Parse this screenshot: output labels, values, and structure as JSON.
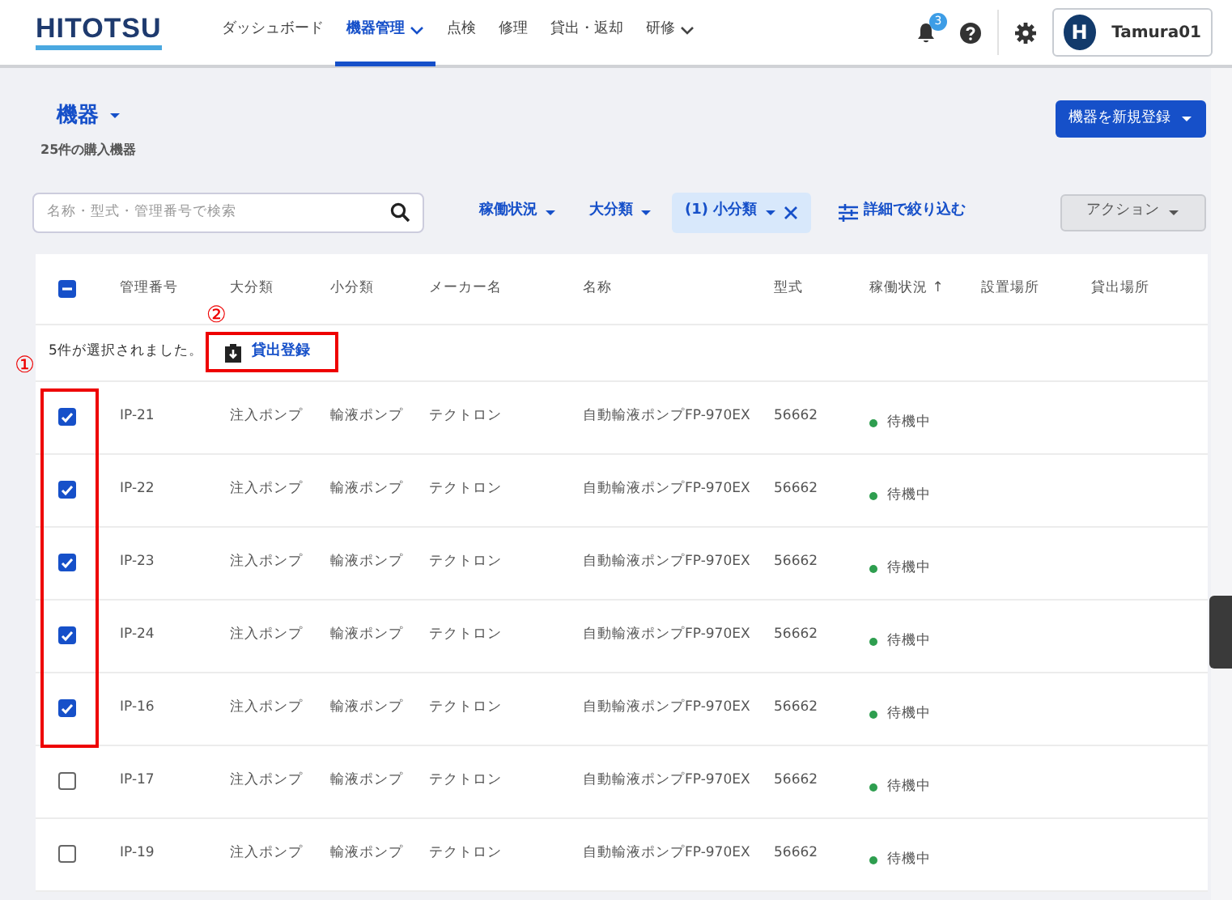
{
  "header": {
    "logo": "HITOTSU",
    "nav": [
      {
        "label": "ダッシュボード",
        "selected": false,
        "dropdown": false
      },
      {
        "label": "機器管理",
        "selected": true,
        "dropdown": true
      },
      {
        "label": "点検",
        "selected": false,
        "dropdown": false
      },
      {
        "label": "修理",
        "selected": false,
        "dropdown": false
      },
      {
        "label": "貸出・返却",
        "selected": false,
        "dropdown": false
      },
      {
        "label": "研修",
        "selected": false,
        "dropdown": true
      }
    ],
    "notification_count": "3",
    "user": {
      "avatar": "H",
      "name": "Tamura01"
    }
  },
  "page": {
    "title": "機器",
    "subtitle": "25件の購入機器",
    "new_button": "機器を新規登録"
  },
  "filters": {
    "search_placeholder": "名称・型式・管理番号で検索",
    "items": [
      {
        "label": "稼働状況",
        "active": false
      },
      {
        "label": "大分類",
        "active": false
      },
      {
        "label": "(1) 小分類",
        "active": true
      }
    ],
    "detail": "詳細で絞り込む",
    "action": "アクション"
  },
  "table": {
    "select_all": {
      "checked": true,
      "indeterminate": true
    },
    "columns": [
      "管理番号",
      "大分類",
      "小分類",
      "メーカー名",
      "名称",
      "型式",
      "稼働状況 ↑",
      "設置場所",
      "貸出場所"
    ],
    "selection": {
      "message": "5件が選択されました。",
      "button": "貸出登録"
    },
    "rows": [
      {
        "checked": true,
        "cells": [
          "IP-21",
          "注入ポンプ",
          "輸液ポンプ",
          "テクトロン",
          "自動輸液ポンプFP-970EX",
          "56662"
        ],
        "status": "待機中"
      },
      {
        "checked": true,
        "cells": [
          "IP-22",
          "注入ポンプ",
          "輸液ポンプ",
          "テクトロン",
          "自動輸液ポンプFP-970EX",
          "56662"
        ],
        "status": "待機中"
      },
      {
        "checked": true,
        "cells": [
          "IP-23",
          "注入ポンプ",
          "輸液ポンプ",
          "テクトロン",
          "自動輸液ポンプFP-970EX",
          "56662"
        ],
        "status": "待機中"
      },
      {
        "checked": true,
        "cells": [
          "IP-24",
          "注入ポンプ",
          "輸液ポンプ",
          "テクトロン",
          "自動輸液ポンプFP-970EX",
          "56662"
        ],
        "status": "待機中"
      },
      {
        "checked": true,
        "cells": [
          "IP-16",
          "注入ポンプ",
          "輸液ポンプ",
          "テクトロン",
          "自動輸液ポンプFP-970EX",
          "56662"
        ],
        "status": "待機中"
      },
      {
        "checked": false,
        "cells": [
          "IP-17",
          "注入ポンプ",
          "輸液ポンプ",
          "テクトロン",
          "自動輸液ポンプFP-970EX",
          "56662"
        ],
        "status": "待機中"
      },
      {
        "checked": false,
        "cells": [
          "IP-19",
          "注入ポンプ",
          "輸液ポンプ",
          "テクトロン",
          "自動輸液ポンプFP-970EX",
          "56662"
        ],
        "status": "待機中"
      }
    ]
  },
  "annotations": [
    {
      "label": "①"
    },
    {
      "label": "②"
    }
  ]
}
